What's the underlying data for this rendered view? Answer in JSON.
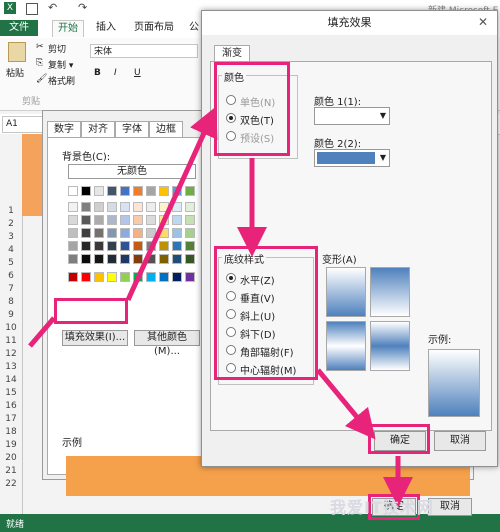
{
  "excel": {
    "window_title": "新建 Microsoft E",
    "tabs": {
      "file": "文件",
      "home": "开始",
      "insert": "插入",
      "page_layout": "页面布局",
      "more": "公"
    },
    "clipboard": {
      "paste": "粘贴",
      "cut": "剪切",
      "copy": "复制 ▾",
      "format_painter": "格式刷",
      "group": "剪贴"
    },
    "font": {
      "name": "宋体",
      "bold": "B",
      "italic": "I",
      "underline": "U"
    },
    "namebox": "A1",
    "rows": [
      "1",
      "2",
      "3",
      "4",
      "5",
      "6",
      "7",
      "8",
      "9",
      "10",
      "11",
      "12",
      "13",
      "14",
      "15",
      "16",
      "17",
      "18",
      "19",
      "20",
      "21",
      "22"
    ],
    "status": "就绪"
  },
  "format_dialog": {
    "tabs": [
      "数字",
      "对齐",
      "字体",
      "边框"
    ],
    "background_label": "背景色(C):",
    "no_color": "无颜色",
    "fill_effects_button": "填充效果(I)...",
    "more_colors_button": "其他颜色(M)...",
    "sample_label": "示例",
    "theme_colors": [
      "#ffffff",
      "#000000",
      "#e7e6e6",
      "#44546a",
      "#4472c4",
      "#ed7d31",
      "#a5a5a5",
      "#ffc000",
      "#5b9bd5",
      "#70ad47"
    ],
    "shade_rows": [
      [
        "#f2f2f2",
        "#7f7f7f",
        "#d0cece",
        "#d6dce4",
        "#d9e2f3",
        "#fbe5d6",
        "#ededed",
        "#fff2cc",
        "#deebf6",
        "#e2efd9"
      ],
      [
        "#d8d8d8",
        "#595959",
        "#aeabab",
        "#adb9ca",
        "#b4c6e7",
        "#f7cbac",
        "#dbdbdb",
        "#fee599",
        "#bdd7ee",
        "#c5e0b3"
      ],
      [
        "#bfbfbf",
        "#3f3f3f",
        "#757171",
        "#8497b0",
        "#8eaadb",
        "#f4b183",
        "#c9c9c9",
        "#ffd965",
        "#9cc3e5",
        "#a8d08d"
      ],
      [
        "#a5a5a5",
        "#262626",
        "#3a3838",
        "#323f4f",
        "#2f5496",
        "#c55a11",
        "#7b7b7b",
        "#bf9000",
        "#2e75b5",
        "#538135"
      ],
      [
        "#7f7f7f",
        "#0c0c0c",
        "#171616",
        "#222a35",
        "#1f3864",
        "#833c0b",
        "#525252",
        "#7f6000",
        "#1e4e79",
        "#375623"
      ]
    ],
    "standard_colors": [
      "#c00000",
      "#ff0000",
      "#ffc000",
      "#ffff00",
      "#92d050",
      "#00b050",
      "#00b0f0",
      "#0070c0",
      "#002060",
      "#7030a0"
    ],
    "sample_color": "#f5a04a"
  },
  "fill_effects": {
    "title": "填充效果",
    "close": "✕",
    "tab": "渐变",
    "colors_group": "颜色",
    "color_options": [
      {
        "label": "单色(N)",
        "checked": false,
        "enabled": false
      },
      {
        "label": "双色(T)",
        "checked": true,
        "enabled": true
      },
      {
        "label": "预设(S)",
        "checked": false,
        "enabled": false
      }
    ],
    "color1_label": "颜色 1(1):",
    "color2_label": "颜色 2(2):",
    "color1": "#ffffff",
    "color2": "#4f81bd",
    "shading_group": "底纹样式",
    "shading_options": [
      {
        "label": "水平(Z)",
        "checked": true
      },
      {
        "label": "垂直(V)",
        "checked": false
      },
      {
        "label": "斜上(U)",
        "checked": false
      },
      {
        "label": "斜下(D)",
        "checked": false
      },
      {
        "label": "角部辐射(F)",
        "checked": false
      },
      {
        "label": "中心辐射(M)",
        "checked": false
      }
    ],
    "variants_label": "变形(A)",
    "sample_label": "示例:",
    "ok": "确定",
    "cancel": "取消",
    "highlight_color": "#e8237a"
  },
  "bottom": {
    "ok": "确定",
    "cancel": "取消"
  },
  "watermark": "我爱IT技术网"
}
